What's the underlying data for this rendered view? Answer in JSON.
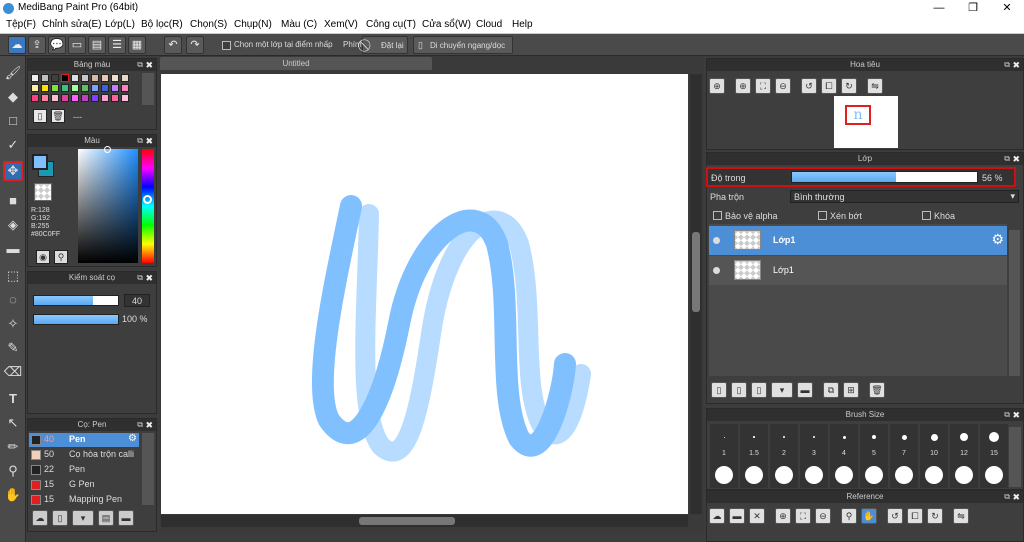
{
  "window": {
    "title": "MediBang Paint Pro (64bit)",
    "minimize": "—",
    "maximize": "❐",
    "close": "✕"
  },
  "menu": [
    "Tệp(F)",
    "Chỉnh sửa(E)",
    "Lớp(L)",
    "Bộ lọc(R)",
    "Chọn(S)",
    "Chụp(N)",
    "Màu (C)",
    "Xem(V)",
    "Công cụ(T)",
    "Cửa sổ(W)",
    "Cloud",
    "Help"
  ],
  "toolbar": {
    "select_layer_label": "Chọn một lớp tại điểm nhấp",
    "key_label": "Phím",
    "reset_label": "Đặt lại",
    "move_label": "Di chuyển ngang/dọc"
  },
  "palette_panel": {
    "title": "Bảng màu",
    "name": "---"
  },
  "color_panel": {
    "title": "Màu",
    "r": "R:128",
    "g": "G:192",
    "b": "B:255",
    "hex": "#80C0FF",
    "fg_color": "#80c0ff",
    "bg_color": "#ffffff"
  },
  "brush_control": {
    "title": "Kiểm soát cọ",
    "size_value": "40",
    "opacity_value": "100 %",
    "size_fraction": 0.7,
    "opacity_fraction": 1.0
  },
  "brush_panel": {
    "title": "Cọ: Pen",
    "items": [
      {
        "size": "40",
        "name": "Pen",
        "color": "#222222"
      },
      {
        "size": "50",
        "name": "Cọ hòa trộn calli",
        "color": "#f0d0b8"
      },
      {
        "size": "22",
        "name": "Pen",
        "color": "#222222"
      },
      {
        "size": "15",
        "name": "G Pen",
        "color": "#e02020"
      },
      {
        "size": "15",
        "name": "Mapping Pen",
        "color": "#e02020"
      }
    ]
  },
  "canvas": {
    "tab_title": "Untitled",
    "stroke_color": "#80c0ff",
    "stroke_light_color": "#b8dcff"
  },
  "navigator": {
    "title": "Hoa tiêu"
  },
  "layer_panel": {
    "title": "Lớp",
    "opacity_label": "Độ trong",
    "opacity_value": "56 %",
    "opacity_fraction": 0.56,
    "blend_label": "Pha trộn",
    "blend_value": "Bình thường",
    "protect_alpha": "Bảo vệ alpha",
    "clipping": "Xén bớt",
    "lock": "Khóa",
    "layers": [
      {
        "name": "Lớp1",
        "selected": true
      },
      {
        "name": "Lớp1",
        "selected": false
      }
    ]
  },
  "brush_size_panel": {
    "title": "Brush Size",
    "sizes": [
      "1",
      "1.5",
      "2",
      "3",
      "4",
      "5",
      "7",
      "10",
      "12",
      "15"
    ]
  },
  "reference_panel": {
    "title": "Reference"
  }
}
